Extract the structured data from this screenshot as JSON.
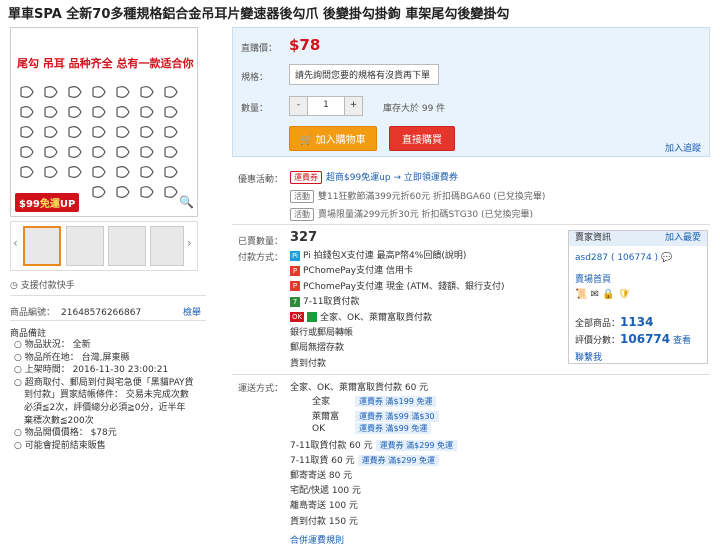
{
  "product": {
    "title": "單車SPA 全新70多種規格鋁合金吊耳片變速器後勾爪 後變掛勾掛鉤 車架尾勾後變掛勾"
  },
  "image": {
    "promo_text": "尾勾 吊耳 品种齐全 总有一款适合你",
    "badge_prefix": "$99",
    "badge_main": "免運",
    "badge_suffix": "UP"
  },
  "support_payment": "支援付款快手",
  "meta": {
    "product_id_label": "商品編號：",
    "product_id": "21648576266867",
    "report_label": "檢舉",
    "notes_title": "商品備註",
    "notes": [
      "物品狀況：  全新",
      "物品所在地：  台灣,屏東縣",
      "上架時間：  2016-11-30 23:00:21",
      "超商取付、郵局到付與宅急便「黑貓PAY貨",
      "到付款」買家結帳條件：  交易未完成次數",
      "必須≦2次，評價總分必須≧0分，近半年",
      "棄標次數≦200次",
      "物品開價價格：  $78元",
      "可能會提前結束販售"
    ]
  },
  "buy_panel": {
    "price_label": "直購價：",
    "price": "$78",
    "spec_label": "規格：",
    "spec_placeholder": "請先詢問您要的規格有沒貨再下單",
    "qty_label": "數量：",
    "qty_minus": "-",
    "qty_value": "1",
    "qty_plus": "+",
    "stock_text": "庫存大於 99 件",
    "add_cart_label": "加入購物車",
    "buy_now_label": "直接購買",
    "add_track_label": "加入追蹤"
  },
  "promotions": {
    "label": "優惠活動：",
    "items": [
      {
        "tag": "運費券",
        "text": "超商$99免運up → 立即領運費券"
      },
      {
        "tag": "活動",
        "text": "雙11狂歡節滿399元折60元 折扣碼BGA60 (已兌換完畢)"
      },
      {
        "tag": "活動",
        "text": "賣場限量滿299元折30元 折扣碼STG30 (已兌換完畢)"
      }
    ]
  },
  "sales": {
    "sold_label": "已賣數量：",
    "sold_value": "327",
    "pay_label": "付款方式：",
    "pay_methods": [
      {
        "icon": "Pi",
        "text": "Pi 拍錢包X支付連  最高P幣4%回饋(說明)"
      },
      {
        "icon": "P",
        "text": "PChomePay支付連 信用卡"
      },
      {
        "icon": "P",
        "text": "PChomePay支付連 現金 (ATM、錢額、銀行支付)"
      },
      {
        "icon": "7",
        "text": "7-11取貨付款"
      },
      {
        "icon": "OK",
        "text": "全家、OK、萊爾富取貨付款"
      },
      {
        "icon": "",
        "text": "銀行或郵局轉帳"
      },
      {
        "icon": "",
        "text": "郵局無摺存款"
      },
      {
        "icon": "",
        "text": "貨到付款"
      }
    ]
  },
  "shipping": {
    "label": "運送方式：",
    "lines": [
      {
        "text": "全家、OK、萊爾富取貨付款 60 元",
        "tag": ""
      },
      {
        "text": "全家",
        "tag": "運費券 滿$199 免運"
      },
      {
        "text": "萊爾富",
        "tag": "運費券 滿$99 滿$30"
      },
      {
        "text": "OK",
        "tag": "運費券 滿$99 免運"
      },
      {
        "text": "7-11取貨付款 60 元",
        "tag": "運費券 滿$299 免運"
      },
      {
        "text": "7-11取貨 60 元",
        "tag": "運費券 滿$299 免運"
      },
      {
        "text": "郵寄寄送 80 元",
        "tag": ""
      },
      {
        "text": "宅配/快遞 100 元",
        "tag": ""
      },
      {
        "text": "離島寄送 100 元",
        "tag": ""
      },
      {
        "text": "貨到付款 150 元",
        "tag": ""
      }
    ],
    "rules_link": "合併運費規則"
  },
  "seller": {
    "head_title": "賣家資訊",
    "follow_label": "加入最愛",
    "name": "asd287 ( 106774 )",
    "store_link": "賣場首頁",
    "total_items_label": "全部商品：",
    "total_items": "1134",
    "rating_label": "評價分數：",
    "rating": "106774",
    "view_label": "查看",
    "contact_label": "聯繫我"
  },
  "colors": {
    "accent_red": "#d2121b",
    "link_blue": "#1a5fb4",
    "cart_orange": "#f39c12",
    "panel_bg": "#e9f3fc"
  }
}
